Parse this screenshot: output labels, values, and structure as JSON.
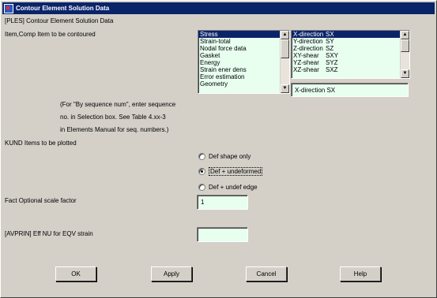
{
  "window": {
    "title": "Contour Element Solution Data"
  },
  "header": {
    "command": "[PLES]  Contour Element Solution Data"
  },
  "item_comp": {
    "label": "Item,Comp   Item to be contoured",
    "items": [
      "Stress",
      "Strain-total",
      "Nodal force data",
      "Gasket",
      "Energy",
      "Strain ener dens",
      "Error estimation",
      "Geometry"
    ],
    "selected_item": "Stress",
    "components": [
      {
        "name": "X-direction",
        "code": "SX"
      },
      {
        "name": "Y-direction",
        "code": "SY"
      },
      {
        "name": "Z-direction",
        "code": "SZ"
      },
      {
        "name": "XY-shear",
        "code": "SXY"
      },
      {
        "name": "YZ-shear",
        "code": "SYZ"
      },
      {
        "name": "XZ-shear",
        "code": "SXZ"
      }
    ],
    "selected_component": "X-direction   SX",
    "selection_value": "X-direction   SX"
  },
  "notes": {
    "line1": "(For \"By sequence num\", enter sequence",
    "line2": "no. in Selection box.  See Table 4.xx-3",
    "line3": "in Elements Manual for seq. numbers.)"
  },
  "kund": {
    "label": "KUND   Items to be plotted",
    "options": [
      "Def shape only",
      "Def + undeformed",
      "Def + undef edge"
    ],
    "selected": "Def + undeformed"
  },
  "fact": {
    "label": "Fact   Optional scale factor",
    "value": "1"
  },
  "avprin": {
    "label": "[AVPRIN]  Eff NU for EQV strain",
    "value": ""
  },
  "buttons": {
    "ok": "OK",
    "apply": "Apply",
    "cancel": "Cancel",
    "help": "Help"
  }
}
